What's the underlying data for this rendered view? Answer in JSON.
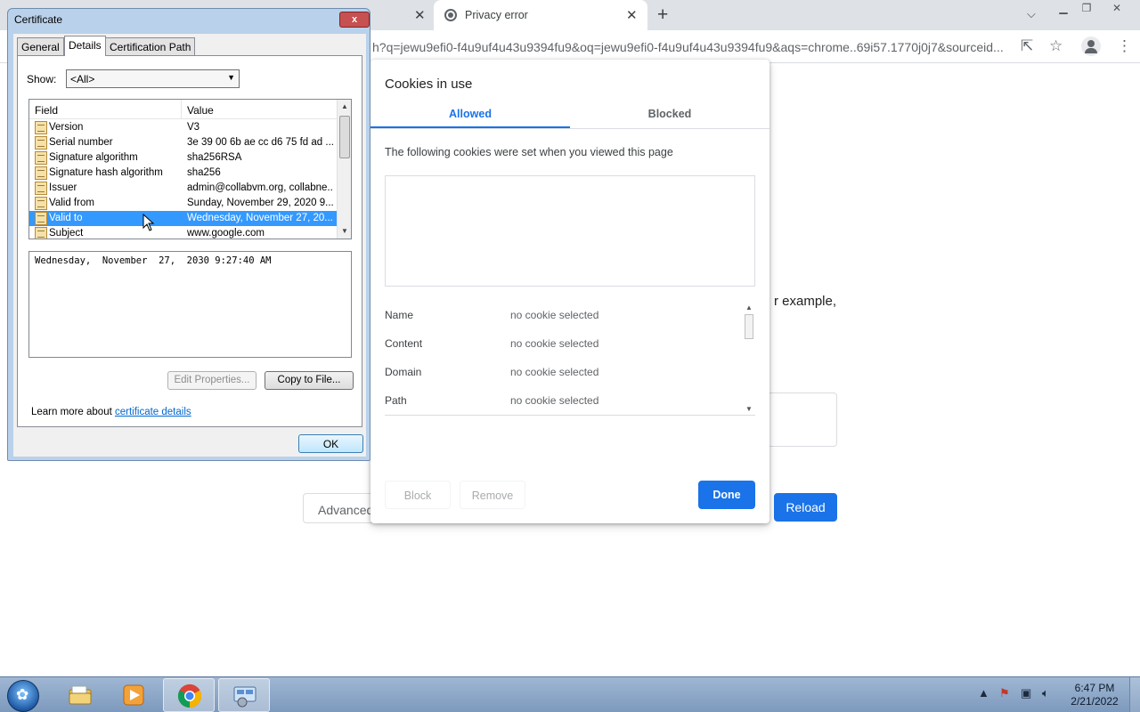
{
  "browser": {
    "tabs": [
      {
        "title": "",
        "active": false
      },
      {
        "title": "Privacy error",
        "active": true
      }
    ],
    "new_tab_label": "+",
    "address": "h?q=jewu9efi0-f4u9uf4u43u9394fu9&oq=jewu9efi0-f4u9uf4u43u9394fu9&aqs=chrome..69i57.1770j0j7&sourceid...",
    "page": {
      "fragment_text": "r example,",
      "advanced_label": "Advanced",
      "reload_label": "Reload"
    }
  },
  "cookies_dialog": {
    "title": "Cookies in use",
    "tabs": [
      "Allowed",
      "Blocked"
    ],
    "selected_tab": "Allowed",
    "description": "The following cookies were set when you viewed this page",
    "details": [
      {
        "label": "Name",
        "value": "no cookie selected"
      },
      {
        "label": "Content",
        "value": "no cookie selected"
      },
      {
        "label": "Domain",
        "value": "no cookie selected"
      },
      {
        "label": "Path",
        "value": "no cookie selected"
      }
    ],
    "buttons": {
      "block": "Block",
      "remove": "Remove",
      "done": "Done"
    },
    "accent": "#1a73e8"
  },
  "certificate_dialog": {
    "title": "Certificate",
    "close_label": "x",
    "tabs": [
      "General",
      "Details",
      "Certification Path"
    ],
    "selected_tab": "Details",
    "show_label": "Show:",
    "show_value": "<All>",
    "columns": [
      "Field",
      "Value"
    ],
    "fields": [
      {
        "field": "Version",
        "value": "V3"
      },
      {
        "field": "Serial number",
        "value": "3e 39 00 6b ae cc d6 75 fd ad ..."
      },
      {
        "field": "Signature algorithm",
        "value": "sha256RSA"
      },
      {
        "field": "Signature hash algorithm",
        "value": "sha256"
      },
      {
        "field": "Issuer",
        "value": "admin@collabvm.org, collabne..."
      },
      {
        "field": "Valid from",
        "value": "Sunday, November 29, 2020 9..."
      },
      {
        "field": "Valid to",
        "value": "Wednesday, November 27, 20..."
      },
      {
        "field": "Subject",
        "value": "www.google.com"
      }
    ],
    "selected_field": "Valid to",
    "selected_value_text": "Wednesday,  November  27,  2030 9:27:40 AM",
    "edit_properties_label": "Edit Properties...",
    "copy_to_file_label": "Copy to File...",
    "learn_more_prefix": "Learn more about ",
    "learn_more_link": "certificate details",
    "ok_label": "OK",
    "selection_color": "#3399ff"
  },
  "taskbar": {
    "apps": [
      {
        "icon": "file-explorer-icon",
        "active": false
      },
      {
        "icon": "media-player-icon",
        "active": false
      },
      {
        "icon": "chrome-icon",
        "active": true
      },
      {
        "icon": "control-panel-icon",
        "active": true
      }
    ],
    "time": "6:47 PM",
    "date": "2/21/2022"
  }
}
